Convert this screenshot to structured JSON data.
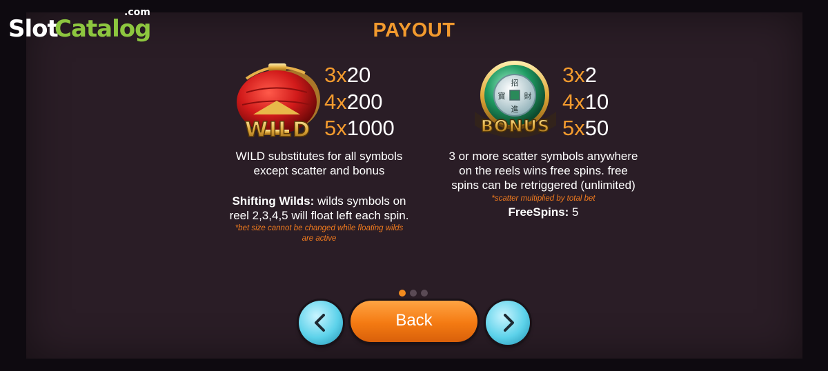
{
  "logo": {
    "part1": "Slot",
    "part2": "Catalog",
    "suffix": ".com"
  },
  "title": "PAYOUT",
  "wild": {
    "symbol_label": "WILD",
    "payouts": [
      {
        "count": "3x",
        "value": "20"
      },
      {
        "count": "4x",
        "value": "200"
      },
      {
        "count": "5x",
        "value": "1000"
      }
    ],
    "desc_line1": "WILD substitutes for all symbols",
    "desc_line2": "except scatter and bonus",
    "shifting_title": "Shifting Wilds:",
    "shifting_text1": " wilds symbols on",
    "shifting_text2": "reel 2,3,4,5 will float left each spin.",
    "note_line1": "*bet size cannot be changed while floating wilds",
    "note_line2": "are active"
  },
  "bonus": {
    "symbol_label": "BONUS",
    "coin_chars": [
      "招",
      "進",
      "寶",
      "財"
    ],
    "payouts": [
      {
        "count": "3x",
        "value": "2"
      },
      {
        "count": "4x",
        "value": "10"
      },
      {
        "count": "5x",
        "value": "50"
      }
    ],
    "desc_line1": "3 or more scatter symbols anywhere",
    "desc_line2": "on the reels wins free spins. free",
    "desc_line3": "spins can be retriggered (unlimited)",
    "note": "*scatter multiplied by total bet",
    "freespins_label": "FreeSpins:",
    "freespins_value": " 5"
  },
  "pagination": {
    "total": 3,
    "active": 1
  },
  "buttons": {
    "back_label": "Back",
    "prev_icon": "chevron-left-icon",
    "next_icon": "chevron-right-icon"
  },
  "colors": {
    "accent": "#f29a2e",
    "note": "#f07a1e",
    "panel": "#2a1d26",
    "button_orange": "#f47a12",
    "button_blue": "#5dd2ea",
    "logo_green": "#8dc63f"
  }
}
